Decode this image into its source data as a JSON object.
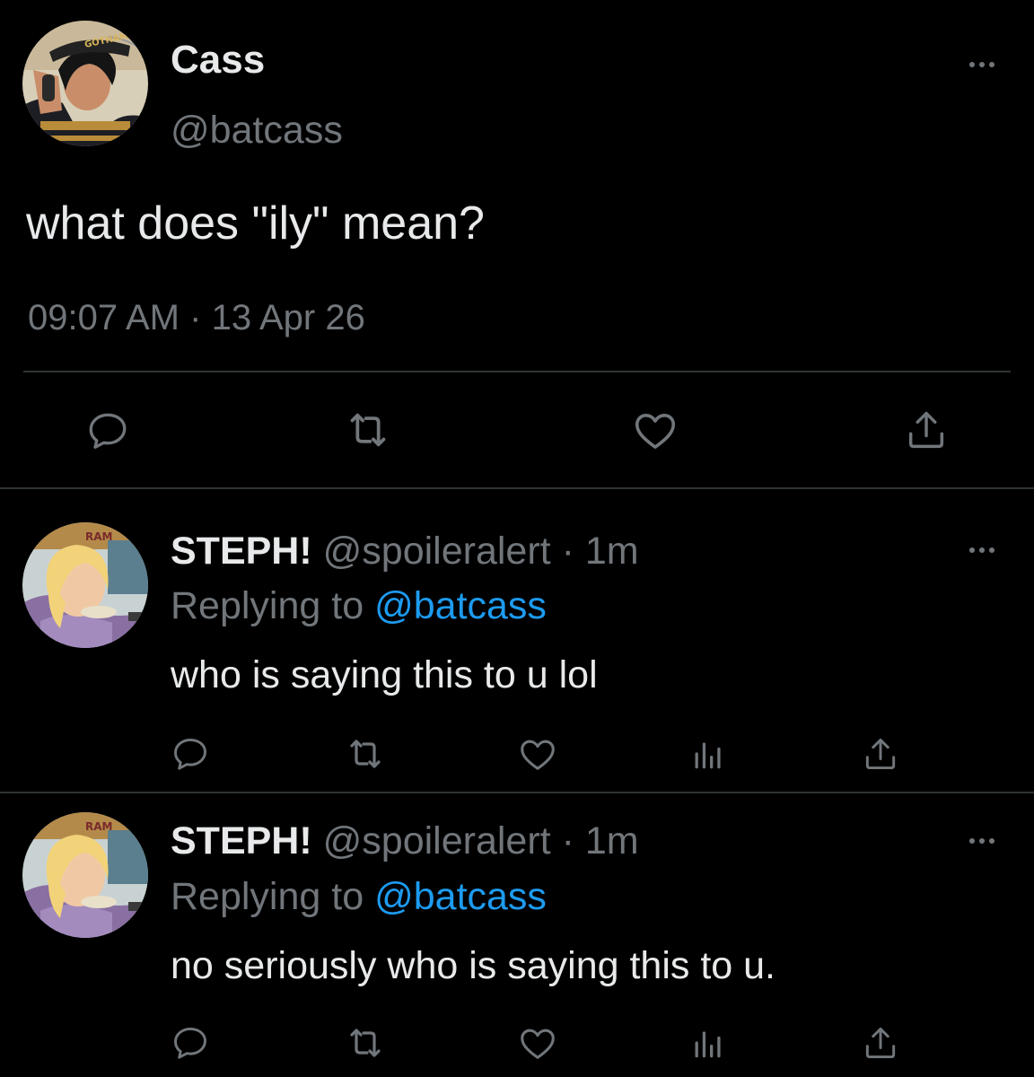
{
  "main_tweet": {
    "display_name": "Cass",
    "handle": "@batcass",
    "text": "what does \"ily\" mean?",
    "time": "09:07 AM",
    "separator": "·",
    "date": "13 Apr 26",
    "avatar": {
      "lettering": "GOTHAM"
    }
  },
  "replies": [
    {
      "display_name": "STEPH!",
      "handle": "@spoileralert",
      "separator": "·",
      "age": "1m",
      "replying_prefix": "Replying to",
      "replying_handle": "@batcass",
      "text": "who is saying this to u lol",
      "avatar": {
        "lettering": "RAM"
      }
    },
    {
      "display_name": "STEPH!",
      "handle": "@spoileralert",
      "separator": "·",
      "age": "1m",
      "replying_prefix": "Replying to",
      "replying_handle": "@batcass",
      "text": "no seriously who is saying this to u.",
      "avatar": {
        "lettering": "RAM"
      }
    }
  ],
  "icons": {
    "main_actions": [
      "reply-icon",
      "retweet-icon",
      "like-icon",
      "share-icon"
    ],
    "reply_actions": [
      "reply-icon",
      "retweet-icon",
      "like-icon",
      "analytics-icon",
      "share-icon"
    ],
    "more": "more-options-icon"
  },
  "colors": {
    "background": "#000000",
    "text": "#e7e9ea",
    "muted": "#71767b",
    "link": "#1d9bf0",
    "divider": "#2f3336"
  }
}
